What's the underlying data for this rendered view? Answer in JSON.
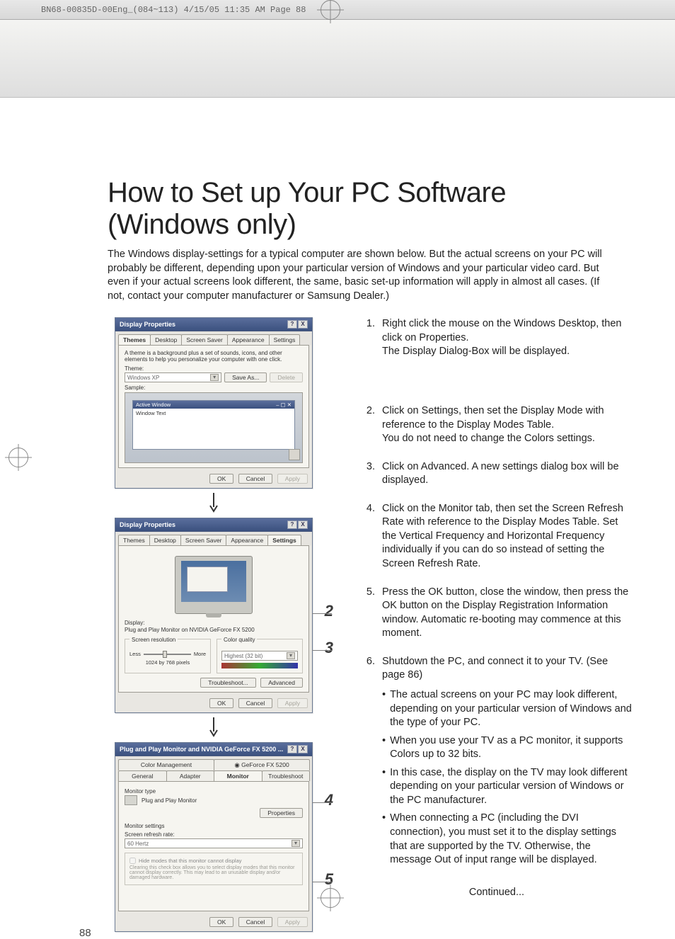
{
  "header_strip": "BN68-00835D-00Eng_(084~113)  4/15/05  11:35 AM  Page 88",
  "title": "How to Set up Your PC Software (Windows only)",
  "intro": "The Windows display-settings for a typical computer are shown below. But the actual screens on your PC will probably be different, depending upon your particular version of Windows and your particular video card. But even if your actual screens look different, the same, basic set-up information will apply in almost all cases. (If not, contact your computer manufacturer or Samsung Dealer.)",
  "page_number": "88",
  "continued": "Continued...",
  "dialog1": {
    "title": "Display Properties",
    "tabs": [
      "Themes",
      "Desktop",
      "Screen Saver",
      "Appearance",
      "Settings"
    ],
    "active_tab": 0,
    "desc": "A theme is a background plus a set of sounds, icons, and other elements to help you personalize your computer with one click.",
    "theme_label": "Theme:",
    "theme_value": "Windows XP",
    "save_as": "Save As...",
    "delete": "Delete",
    "sample_label": "Sample:",
    "active_window": "Active Window",
    "window_text": "Window Text",
    "ok": "OK",
    "cancel": "Cancel",
    "apply": "Apply"
  },
  "dialog2": {
    "title": "Display Properties",
    "tabs": [
      "Themes",
      "Desktop",
      "Screen Saver",
      "Appearance",
      "Settings"
    ],
    "active_tab": 4,
    "display_label": "Display:",
    "display_value": "Plug and Play Monitor on NVIDIA GeForce FX 5200",
    "res_label": "Screen resolution",
    "res_less": "Less",
    "res_more": "More",
    "res_value": "1024 by 768 pixels",
    "color_label": "Color quality",
    "color_value": "Highest (32 bit)",
    "troubleshoot": "Troubleshoot...",
    "advanced": "Advanced",
    "ok": "OK",
    "cancel": "Cancel",
    "apply": "Apply"
  },
  "dialog3": {
    "title": "Plug and Play Monitor and NVIDIA GeForce FX 5200 ...",
    "tabs_row1": [
      "Color Management",
      "GeForce FX 5200"
    ],
    "tabs_row2": [
      "General",
      "Adapter",
      "Monitor",
      "Troubleshoot"
    ],
    "active_tab_r2": 2,
    "montype_label": "Monitor type",
    "montype_value": "Plug and Play Monitor",
    "properties": "Properties",
    "monset_label": "Monitor settings",
    "refresh_label": "Screen refresh rate:",
    "refresh_value": "60 Hertz",
    "hide_label": "Hide modes that this monitor cannot display",
    "hide_desc": "Clearing this check box allows you to select display modes that this monitor cannot display correctly. This may lead to an unusable display and/or damaged hardware.",
    "ok": "OK",
    "cancel": "Cancel",
    "apply": "Apply"
  },
  "side_numbers": {
    "n2": "2",
    "n3": "3",
    "n4": "4",
    "n5": "5"
  },
  "steps": [
    {
      "n": "1.",
      "body": "Right click the mouse on the Windows Desktop, then click on Properties.\nThe Display Dialog-Box will be displayed."
    },
    {
      "n": "2.",
      "body": "Click on Settings, then set the Display Mode with reference to the Display Modes Table.\nYou do not need to change the Colors settings."
    },
    {
      "n": "3.",
      "body": "Click on Advanced. A new settings dialog box will be displayed."
    },
    {
      "n": "4.",
      "body": "Click on the Monitor tab, then set the Screen Refresh Rate with reference to the Display Modes Table. Set the Vertical Frequency and Horizontal Frequency individually if you can do so instead of setting the Screen Refresh Rate."
    },
    {
      "n": "5.",
      "body": "Press the OK button, close the window, then press the OK button on the Display Registration Information window. Automatic re-booting may commence at this moment."
    },
    {
      "n": "6.",
      "body": "Shutdown the PC, and connect it to your TV. (See page 86)"
    }
  ],
  "bullets": [
    "The actual screens on your PC may look different, depending on your particular version of Windows and the type of your PC.",
    "When you use your TV as a PC monitor, it supports Colors up to 32 bits.",
    "In this case, the display on the TV may look different depending on your particular version of Windows or the PC manufacturer.",
    "When connecting a PC (including the DVI connection), you must set it to the display settings that are supported by the TV. Otherwise, the message Out of input range will be displayed."
  ]
}
